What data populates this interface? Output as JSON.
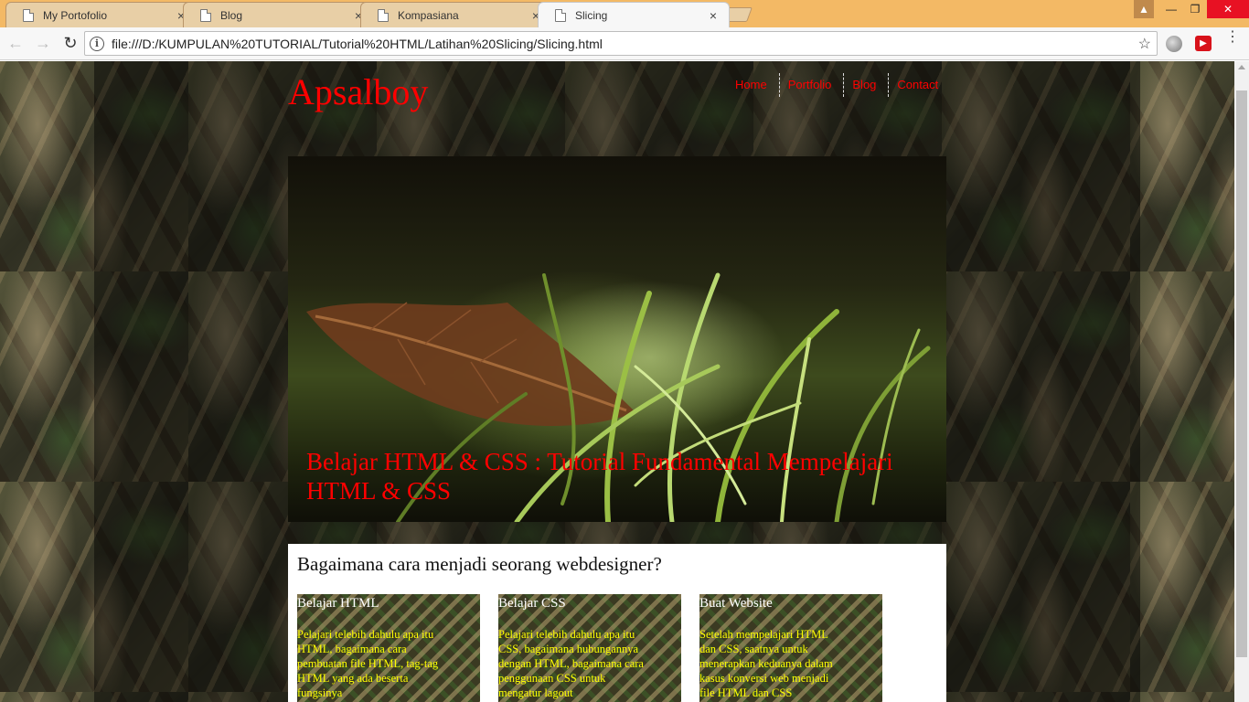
{
  "browser": {
    "tabs": [
      {
        "title": "My Portofolio"
      },
      {
        "title": "Blog"
      },
      {
        "title": "Kompasiana"
      },
      {
        "title": "Slicing"
      }
    ],
    "tab_close_glyph": "×",
    "address": "file:///D:/KUMPULAN%20TUTORIAL/Tutorial%20HTML/Latihan%20Slicing/Slicing.html",
    "info_glyph": "i",
    "star_glyph": "☆",
    "menu_glyph": "⋮",
    "back_glyph": "←",
    "forward_glyph": "→",
    "reload_glyph": "↻",
    "minimize_glyph": "—",
    "maximize_glyph": "❐",
    "close_glyph": "✕",
    "user_glyph": "▲",
    "active_tab": "Slicing",
    "colors": {
      "tabstrip": "#f3b965",
      "close": "#e81123"
    }
  },
  "page": {
    "logo": "Apsalboy",
    "nav": [
      "Home",
      "Portfolio",
      "Blog",
      "Contact"
    ],
    "hero_title": "Belajar HTML & CSS : Tutorial Fundamental Mempelajari HTML & CSS",
    "section_heading": "Bagaimana cara menjadi seorang webdesigner?",
    "cards": [
      {
        "title": "Belajar HTML",
        "text": "Pelajari telebih dahulu apa itu HTML, bagaimana cara pembuatan file HTML, tag-tag HTML yang ada beserta fungsinya"
      },
      {
        "title": "Belajar CSS",
        "text": "Pelajari telebih dahulu apa itu CSS, bagaimana hubungannya dengan HTML, bagaimana cara penggunaan CSS untuk mengatur lagout"
      },
      {
        "title": "Buat Website",
        "text": "Setelah mempelajari HTML dan CSS, saatnya untuk menerapkan keduanya dalam kasus konversi web menjadi file HTML dan CSS"
      }
    ],
    "colors": {
      "accent": "#ff0000",
      "card_text": "#ffff00"
    }
  }
}
